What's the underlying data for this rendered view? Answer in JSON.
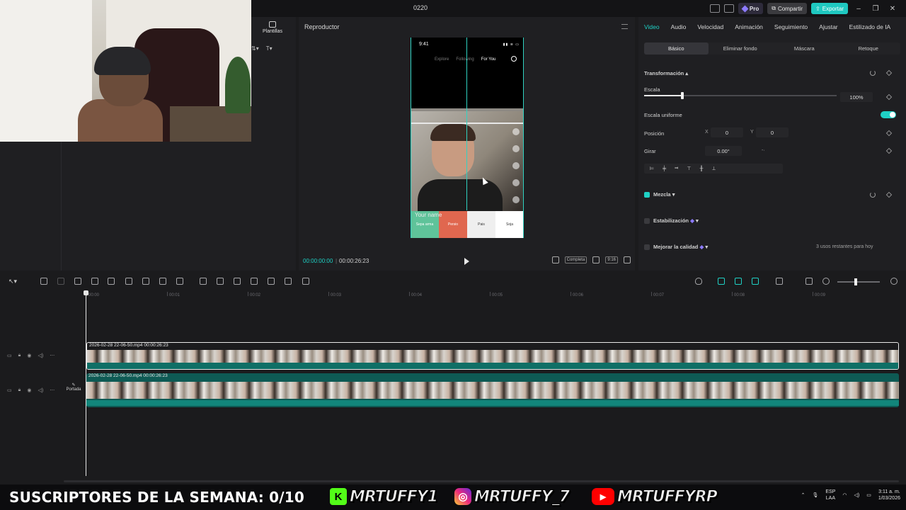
{
  "window": {
    "title": "0220"
  },
  "titlebar": {
    "pro": "Pro",
    "share": "Compartir",
    "export": "Exportar"
  },
  "media_panel": {
    "nav_label": "Plantillas"
  },
  "player": {
    "title": "Reproductor",
    "phone": {
      "time": "9:41",
      "tabs": [
        "Explore",
        "Following",
        "For You"
      ],
      "your_name": "Your name",
      "bottom_labels": [
        "Sepa arma",
        "Persio",
        "Pais",
        "Soja"
      ]
    },
    "current_time": "00:00:00:00",
    "total_time": "00:00:26:23",
    "full_label": "Completa",
    "ratio_label": "9:16"
  },
  "props": {
    "tabs": [
      "Video",
      "Audio",
      "Velocidad",
      "Animación",
      "Seguimiento",
      "Ajustar",
      "Estilizado de IA"
    ],
    "active_tab": "Video",
    "subtabs": [
      "Básico",
      "Eliminar fondo",
      "Máscara",
      "Retoque"
    ],
    "active_subtab": "Básico",
    "transform_label": "Transformación",
    "scale_label": "Escala",
    "scale_value": "100%",
    "scale_level": 0.2,
    "uniform_label": "Escala uniforme",
    "position_label": "Posición",
    "x_label": "X",
    "x_value": "0",
    "y_label": "Y",
    "y_value": "0",
    "rotate_label": "Girar",
    "rotate_value": "0.00°",
    "blend_label": "Mezcla",
    "stabilize_label": "Estabilización",
    "enhance_label": "Mejorar la calidad",
    "enhance_note": "3 usos restantes para hoy"
  },
  "timeline": {
    "ruler": [
      "00:00",
      "00:01",
      "00:02",
      "00:03",
      "00:04",
      "00:05",
      "00:06",
      "00:07",
      "00:08",
      "00:09"
    ],
    "clip1": {
      "name": "2026-02-28 22-06-50.mp4",
      "duration": "00:00:26:23"
    },
    "clip2": {
      "name": "2026-02-28 22-06-50.mp4",
      "duration": "00:00:26:23"
    },
    "cover_label": "Portada"
  },
  "overlay": {
    "subs_text": "SUSCRIPTORES DE LA SEMANA: 0/10",
    "kick_handle": "MRTUFFY1",
    "instagram_handle": "MRTUFFY_7",
    "youtube_handle": "MRTUFFYRP"
  },
  "tray": {
    "lang": "ESP",
    "layout": "LAA",
    "time": "3:11 a. m.",
    "date": "1/03/2026"
  },
  "colors": {
    "accent": "#1fd1c5",
    "panel": "#1f1f22",
    "background": "#1b1b1d"
  }
}
